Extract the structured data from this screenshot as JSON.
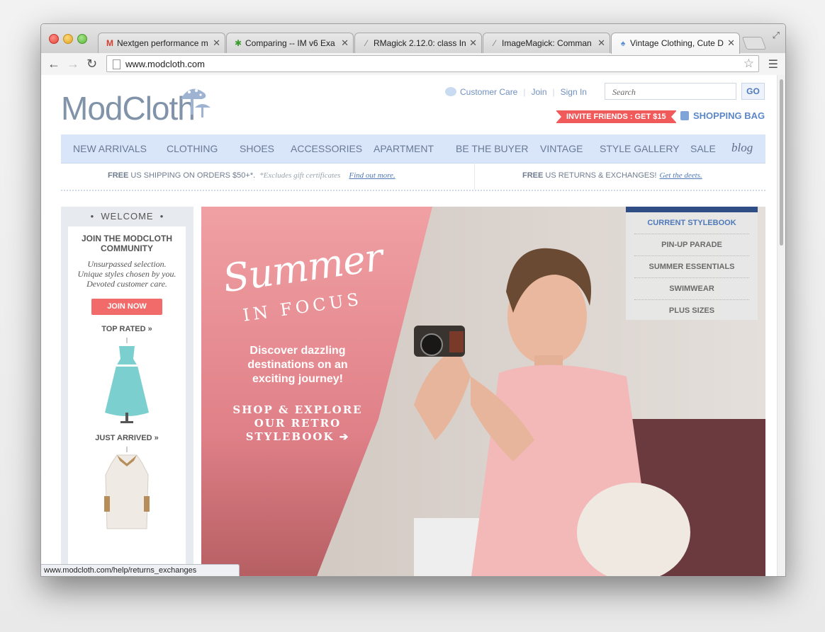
{
  "browser": {
    "tabs": [
      {
        "title": "Nextgen performance m",
        "favicon": "gmail-icon",
        "active": false
      },
      {
        "title": "Comparing -- IM v6 Exa",
        "favicon": "star-icon",
        "active": false
      },
      {
        "title": "RMagick 2.12.0: class In",
        "favicon": "pen-icon",
        "active": false
      },
      {
        "title": "ImageMagick: Comman",
        "favicon": "pen-icon",
        "active": false
      },
      {
        "title": "Vintage Clothing, Cute D",
        "favicon": "mushroom-icon",
        "active": true
      }
    ],
    "url": "www.modcloth.com",
    "status_url": "www.modcloth.com/help/returns_exchanges"
  },
  "header": {
    "logo_text": "ModCloth",
    "customer_care": "Customer Care",
    "join": "Join",
    "sign_in": "Sign In",
    "search_placeholder": "Search",
    "go": "GO",
    "invite": "INVITE FRIENDS : GET $15",
    "bag": "SHOPPING BAG"
  },
  "nav": {
    "items": [
      "NEW ARRIVALS",
      "CLOTHING",
      "SHOES",
      "ACCESSORIES",
      "APARTMENT",
      "BE THE BUYER",
      "VINTAGE",
      "STYLE GALLERY",
      "SALE"
    ],
    "blog": "blog"
  },
  "shipping": {
    "left_bold": "FREE",
    "left_text": "US SHIPPING ON ORDERS $50+*.",
    "left_note": "*Excludes gift certificates",
    "left_link": "Find out more.",
    "right_bold": "FREE",
    "right_text": "US RETURNS & EXCHANGES!",
    "right_link": "Get the deets."
  },
  "sidebar": {
    "welcome": "WELCOME",
    "title": "JOIN THE MODCLOTH COMMUNITY",
    "line1": "Unsurpassed selection.",
    "line2": "Unique styles chosen by you.",
    "line3": "Devoted customer care.",
    "join_btn": "JOIN NOW",
    "top_rated": "TOP RATED »",
    "just_arrived": "JUST ARRIVED »"
  },
  "hero": {
    "script": "Summer",
    "subtitle": "IN FOCUS",
    "copy1": "Discover dazzling",
    "copy2": "destinations on an",
    "copy3": "exciting journey!",
    "cta1": "SHOP & EXPLORE",
    "cta2": "OUR RETRO",
    "cta3": "STYLEBOOK ➔",
    "stylebook": [
      "CURRENT STYLEBOOK",
      "PIN-UP PARADE",
      "SUMMER ESSENTIALS",
      "SWIMWEAR",
      "PLUS SIZES"
    ]
  },
  "colors": {
    "accent_blue": "#4f79b8",
    "nav_bg": "#d9e6fa",
    "coral": "#f05a5a",
    "logo": "#8093a8"
  }
}
